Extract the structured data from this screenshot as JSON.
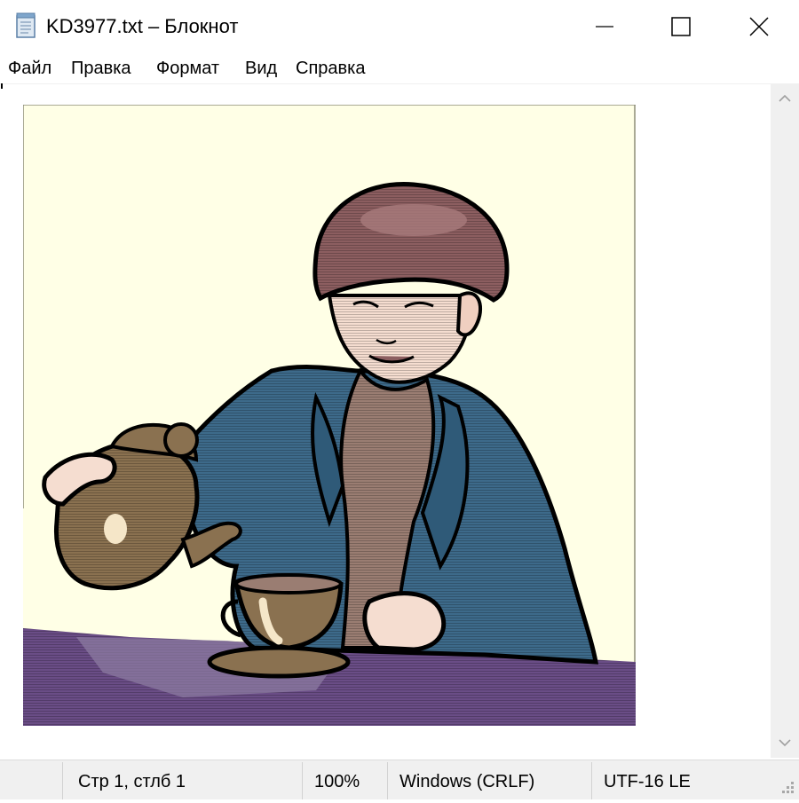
{
  "window": {
    "title": "KD3977.txt – Блокнот",
    "icon": "notepad-icon",
    "controls": [
      "minimize-icon",
      "maximize-icon",
      "close-icon"
    ]
  },
  "menu": {
    "items": [
      "Файл",
      "Правка",
      "Формат",
      "Вид",
      "Справка"
    ]
  },
  "scrollbar": {
    "up_icon": "chevron-up-icon",
    "down_icon": "chevron-down-icon"
  },
  "status": {
    "position": "Стр 1, стлб 1",
    "zoom": "100%",
    "line_endings": "Windows (CRLF)",
    "encoding": "UTF-16 LE"
  },
  "colors": {
    "background": "#ffffcc",
    "jacket": "#3d6a8a",
    "hat": "#8c5e60",
    "skin": "#f5ddd0",
    "teapot": "#8a7150",
    "table": "#6a4d86",
    "outline": "#000000",
    "statusbar": "#f0f0f0"
  }
}
